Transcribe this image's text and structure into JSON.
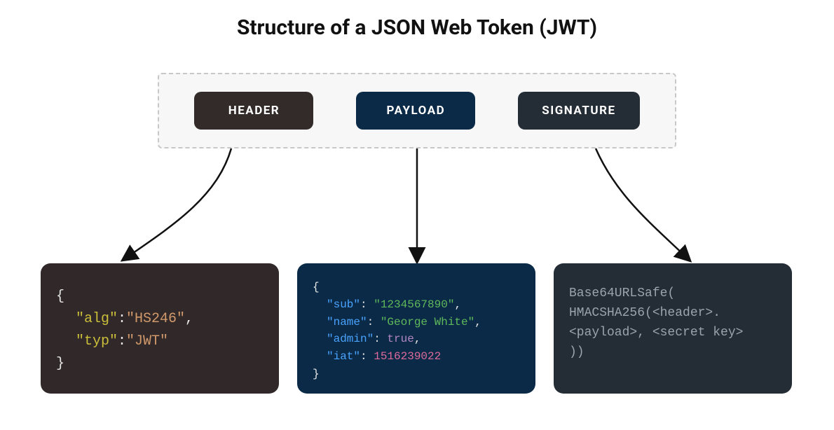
{
  "title": "Structure of a JSON Web Token (JWT)",
  "parts": {
    "header_label": "HEADER",
    "payload_label": "PAYLOAD",
    "signature_label": "SIGNATURE"
  },
  "header_panel": {
    "open": "{",
    "alg_k": "\"alg\"",
    "alg_v": "\"HS246\"",
    "typ_k": "\"typ\"",
    "typ_v": "\"JWT\"",
    "close": "}"
  },
  "payload_panel": {
    "open": "{",
    "sub_k": "\"sub\"",
    "sub_v": "\"1234567890\"",
    "name_k": "\"name\"",
    "name_v": "\"George White\"",
    "admin_k": "\"admin\"",
    "admin_v": "true",
    "iat_k": "\"iat\"",
    "iat_v": "1516239022",
    "close": "}"
  },
  "signature_panel": {
    "l1": "Base64URLSafe(",
    "l2": "HMACSHA256(<header>.",
    "l3": "<payload>, <secret key>",
    "l4": "))"
  }
}
